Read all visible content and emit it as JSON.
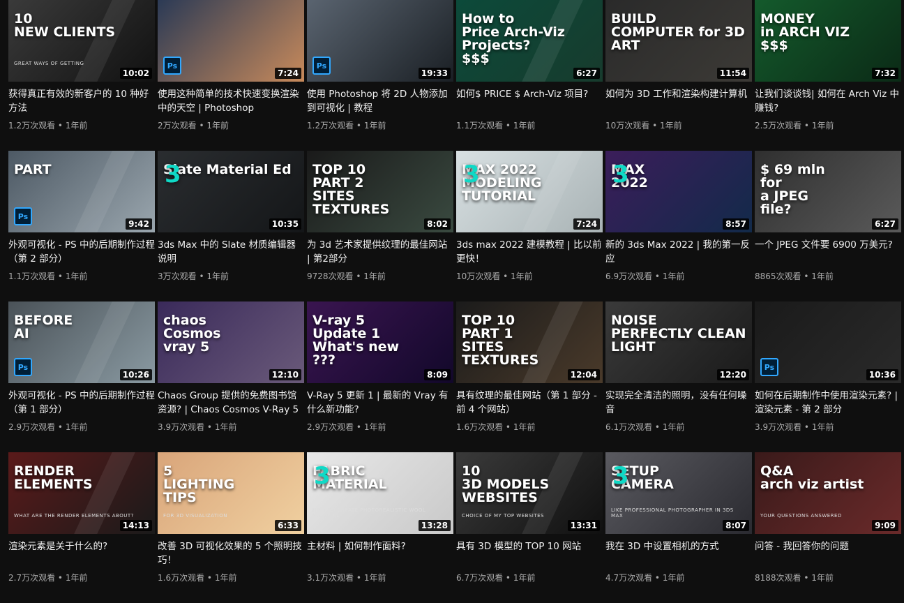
{
  "accent": "#0fd9c6",
  "videos": [
    {
      "thumb_text": "10\nNEW CLIENTS",
      "thumb_sub": "GREAT WAYS OF GETTING",
      "duration": "10:02",
      "title": "获得真正有效的新客户的 10 种好方法",
      "views": "1.2万次观看",
      "age": "1年前"
    },
    {
      "thumb_text": "",
      "badge": "Ps",
      "duration": "7:24",
      "title": "使用这种简单的技术快速变换渲染中的天空 | Photoshop",
      "views": "2万次观看",
      "age": "1年前"
    },
    {
      "thumb_text": "",
      "badge": "Ps",
      "duration": "19:33",
      "title": "使用 Photoshop 将 2D 人物添加到可视化 | 教程",
      "views": "1.2万次观看",
      "age": "1年前"
    },
    {
      "thumb_text": "How to\nPrice Arch-Viz\nProjects?\n$$$",
      "duration": "6:27",
      "title": "如何$ PRICE $ Arch-Viz 项目?",
      "views": "1.1万次观看",
      "age": "1年前"
    },
    {
      "thumb_text": "BUILD\nCOMPUTER for 3D ART",
      "duration": "11:54",
      "title": "如何为 3D 工作和渲染构建计算机",
      "views": "10万次观看",
      "age": "1年前"
    },
    {
      "thumb_text": "MONEY\nin ARCH VIZ\n$$$",
      "duration": "7:32",
      "title": "让我们谈谈钱| 如何在 Arch Viz 中赚钱?",
      "views": "2.5万次观看",
      "age": "1年前"
    },
    {
      "thumb_text": "PART",
      "badge": "Ps",
      "duration": "9:42",
      "title": "外观可视化 - PS 中的后期制作过程（第 2 部分）",
      "views": "1.1万次观看",
      "age": "1年前"
    },
    {
      "thumb_text": "Slate Material Ed",
      "max": "3",
      "duration": "10:35",
      "title": "3ds Max 中的 Slate 材质编辑器说明",
      "views": "3万次观看",
      "age": "1年前"
    },
    {
      "thumb_text": "TOP 10\nPART 2\nSITES\nTEXTURES",
      "duration": "8:02",
      "title": "为 3d 艺术家提供纹理的最佳网站 | 第2部分",
      "views": "9728次观看",
      "age": "1年前"
    },
    {
      "thumb_text": "MAX 2022\nMODELING\nTUTORIAL",
      "max": "3",
      "duration": "7:24",
      "title": "3ds max 2022 建模教程 | 比以前更快！",
      "views": "10万次观看",
      "age": "1年前"
    },
    {
      "thumb_text": "MAX\n2022",
      "max": "3",
      "duration": "8:57",
      "title": "新的 3ds Max 2022 | 我的第一反应",
      "views": "6.9万次观看",
      "age": "1年前"
    },
    {
      "thumb_text": "$ 69 mln\nfor\na JPEG\nfile?",
      "duration": "6:27",
      "title": "一个 JPEG 文件要 6900 万美元?",
      "views": "8865次观看",
      "age": "1年前"
    },
    {
      "thumb_text": "BEFORE\nAI",
      "badge": "Ps",
      "duration": "10:26",
      "title": "外观可视化 - PS 中的后期制作过程（第 1 部分）",
      "views": "2.9万次观看",
      "age": "1年前"
    },
    {
      "thumb_text": "chaos\nCosmos\nvray 5",
      "duration": "12:10",
      "title": "Chaos Group 提供的免费图书馆资源? | Chaos Cosmos V-Ray 5",
      "views": "3.9万次观看",
      "age": "1年前"
    },
    {
      "thumb_text": "V-ray 5\nUpdate 1\nWhat's new\n???",
      "duration": "8:09",
      "title": "V-Ray 5 更新 1 | 最新的 Vray 有什么新功能?",
      "views": "2.9万次观看",
      "age": "1年前"
    },
    {
      "thumb_text": "TOP 10\nPART 1\nSITES\nTEXTURES",
      "duration": "12:04",
      "title": "具有纹理的最佳网站（第 1 部分 - 前 4 个网站）",
      "views": "1.6万次观看",
      "age": "1年前"
    },
    {
      "thumb_text": "NOISE\nPERFECTLY CLEAN LIGHT",
      "duration": "12:20",
      "title": "实现完全清洁的照明，没有任何噪音",
      "views": "6.1万次观看",
      "age": "1年前"
    },
    {
      "thumb_text": "",
      "badge": "Ps",
      "duration": "10:36",
      "title": "如何在后期制作中使用渲染元素? | 渲染元素 - 第 2 部分",
      "views": "3.9万次观看",
      "age": "1年前"
    },
    {
      "thumb_text": "RENDER\nELEMENTS",
      "thumb_sub": "WHAT ARE THE RENDER ELEMENTS ABOUT?",
      "duration": "14:13",
      "title": "渲染元素是关于什么的?",
      "views": "2.7万次观看",
      "age": "1年前"
    },
    {
      "thumb_text": "5\nLIGHTING\nTIPS",
      "thumb_sub": "FOR 3D VISUALIZATION",
      "duration": "6:33",
      "title": "改善 3D 可视化效果的 5 个照明技巧！",
      "views": "1.6万次观看",
      "age": "1年前"
    },
    {
      "thumb_text": "FABRIC\nMATERIAL",
      "thumb_sub": "HOW TO CREATE PHOTOREALISTIC WOOL MATERIAL",
      "max": "3",
      "duration": "13:28",
      "title": "主材料 | 如何制作面料?",
      "views": "3.1万次观看",
      "age": "1年前"
    },
    {
      "thumb_text": "10\n3D MODELS\nWEBSITES",
      "thumb_sub": "CHOICE OF MY TOP WEBSITES",
      "duration": "13:31",
      "title": "具有 3D 模型的 TOP 10 网站",
      "views": "6.7万次观看",
      "age": "1年前"
    },
    {
      "thumb_text": "SETUP\nCAMERA",
      "thumb_sub": "LIKE PROFESSIONAL PHOTOGRAPHER IN 3DS MAX",
      "max": "3",
      "duration": "8:07",
      "title": "我在 3D 中设置相机的方式",
      "views": "4.7万次观看",
      "age": "1年前"
    },
    {
      "thumb_text": "Q&A\narch viz artist",
      "thumb_sub": "YOUR QUESTIONS ANSWERED",
      "duration": "9:09",
      "title": "问答 - 我回答你的问题",
      "views": "8188次观看",
      "age": "1年前"
    }
  ]
}
